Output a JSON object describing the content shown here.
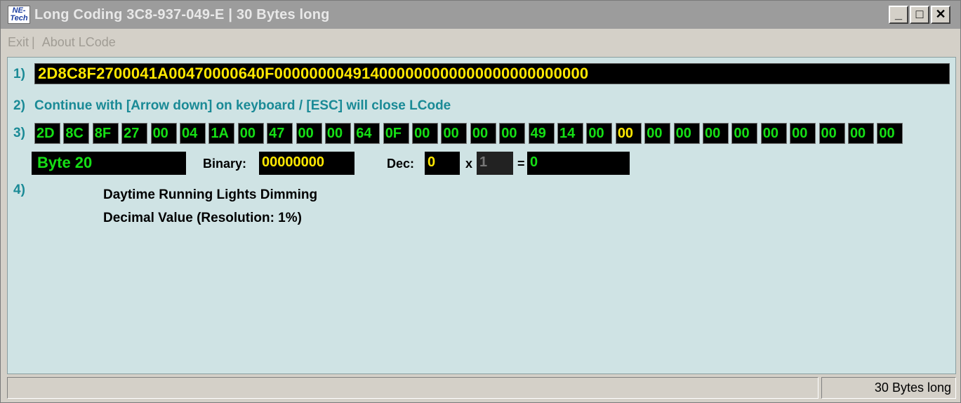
{
  "window": {
    "app_icon_text": "NE-\nTech",
    "title": "Long Coding  3C8-937-049-E | 30 Bytes long",
    "controls": {
      "minimize": "_",
      "maximize": "□",
      "close": "✕"
    }
  },
  "menu": [
    {
      "label": "Exit"
    },
    {
      "label": "About LCode"
    }
  ],
  "step1": {
    "number": "1)",
    "coding_string": "2D8C8F2700041A00470000640F000000004914000000000000000000000000"
  },
  "step2": {
    "number": "2)",
    "instruction": "Continue with [Arrow down] on keyboard / [ESC] will close LCode"
  },
  "step3": {
    "number": "3)",
    "bytes": [
      "2D",
      "8C",
      "8F",
      "27",
      "00",
      "04",
      "1A",
      "00",
      "47",
      "00",
      "00",
      "64",
      "0F",
      "00",
      "00",
      "00",
      "00",
      "49",
      "14",
      "00",
      "00",
      "00",
      "00",
      "00",
      "00",
      "00",
      "00",
      "00",
      "00",
      "00"
    ],
    "selected_index": 20,
    "byte_label": "Byte 20",
    "binary_label": "Binary:",
    "binary_value": "00000000",
    "dec_label": "Dec:",
    "dec_value": "0",
    "times_sign": "x",
    "multiplier": "1",
    "equals_sign": "=",
    "result": "0"
  },
  "step4": {
    "number": "4)",
    "line1": "Daytime Running Lights Dimming",
    "line2": "Decimal Value (Resolution: 1%)"
  },
  "statusbar": {
    "left_text": "",
    "right_text": "30 Bytes long"
  },
  "colors": {
    "title_bar": "#9c9c9c",
    "client_bg": "#cfe3e4",
    "step_text": "#1a8a96",
    "hex_yellow": "#ffe800",
    "hex_green": "#15e015"
  }
}
